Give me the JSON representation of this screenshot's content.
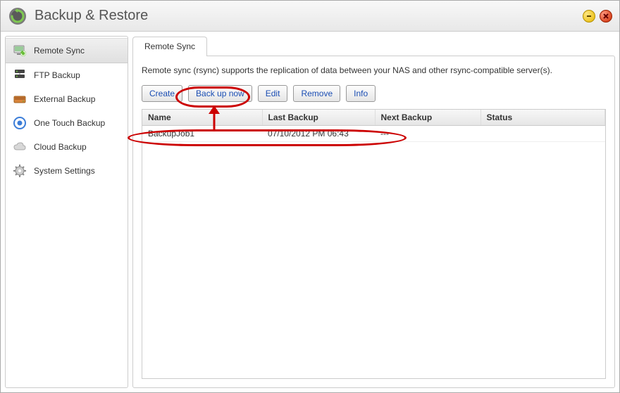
{
  "header": {
    "title": "Backup & Restore"
  },
  "sidebar": {
    "items": [
      {
        "label": "Remote Sync"
      },
      {
        "label": "FTP Backup"
      },
      {
        "label": "External Backup"
      },
      {
        "label": "One Touch Backup"
      },
      {
        "label": "Cloud Backup"
      },
      {
        "label": "System Settings"
      }
    ]
  },
  "tabs": [
    {
      "label": "Remote Sync"
    }
  ],
  "main": {
    "description": "Remote sync (rsync) supports the replication of data between your NAS and other rsync-compatible server(s).",
    "toolbar": {
      "create": "Create",
      "backup_now": "Back up now",
      "edit": "Edit",
      "remove": "Remove",
      "info": "Info"
    },
    "table": {
      "headers": {
        "name": "Name",
        "last_backup": "Last Backup",
        "next_backup": "Next Backup",
        "status": "Status"
      },
      "rows": [
        {
          "name": "BackupJob1",
          "last_backup": "07/10/2012 PM 06:43",
          "next_backup": "---",
          "status": ""
        }
      ]
    }
  }
}
